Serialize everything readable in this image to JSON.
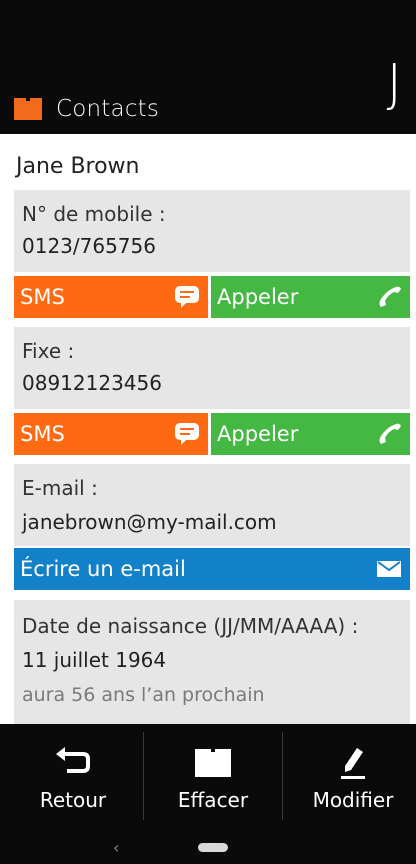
{
  "header": {
    "title": "Contacts",
    "letter": "J",
    "icon": "book-icon"
  },
  "contact": {
    "name": "Jane Brown",
    "mobile": {
      "label": "N° de mobile :",
      "value": "0123/765756"
    },
    "landline": {
      "label": "Fixe :",
      "value": "08912123456"
    },
    "email": {
      "label": "E-mail :",
      "value": "janebrown@my-mail.com"
    },
    "birthday": {
      "label": "Date de naissance (JJ/MM/AAAA) :",
      "value": "11 juillet 1964",
      "note": "aura 56 ans l’an prochain"
    }
  },
  "actions": {
    "sms_label": "SMS",
    "call_label": "Appeler",
    "email_label": "Écrire un e-mail"
  },
  "footer": {
    "back_label": "Retour",
    "delete_label": "Effacer",
    "edit_label": "Modifier"
  },
  "navbar": {
    "back_glyph": "‹"
  },
  "colors": {
    "sms": "#ff6a13",
    "call": "#45b843",
    "email": "#1281c9",
    "header_icon": "#f26a1b",
    "card_bg": "#e6e6e6"
  }
}
